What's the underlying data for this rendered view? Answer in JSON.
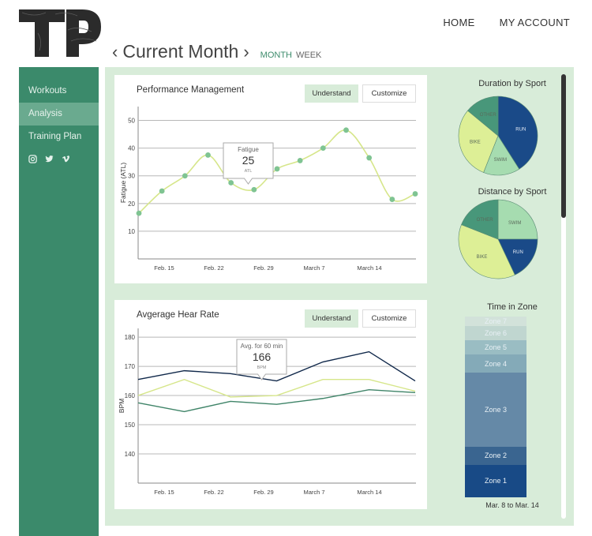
{
  "brand": {
    "logo_text": "TP"
  },
  "topnav": {
    "home": "HOME",
    "account": "MY ACCOUNT"
  },
  "month_bar": {
    "prev": "‹",
    "title": "Current Month",
    "next": "›",
    "month_toggle": "MONTH",
    "week_toggle": "WEEK"
  },
  "sidebar": {
    "items": [
      {
        "label": "Workouts",
        "active": false
      },
      {
        "label": "Analysis",
        "active": true
      },
      {
        "label": "Training Plan",
        "active": false
      }
    ],
    "social": [
      "instagram-icon",
      "twitter-icon",
      "vimeo-icon"
    ]
  },
  "buttons": {
    "understand": "Understand",
    "customize": "Customize"
  },
  "colors": {
    "sidebar": "#3b8a6b",
    "panel_bg": "#d8ecd9",
    "fatigue_line": "#d6e68a",
    "fatigue_dot": "#7fc492",
    "hr_dark": "#10284a",
    "hr_light": "#d6e68a",
    "hr_green": "#3f8468"
  },
  "chart_data": [
    {
      "type": "line",
      "title": "Performance Management",
      "ylabel": "Fatigue (ATL)",
      "xlabel": "",
      "ylim": [
        0,
        55
      ],
      "y_ticks": [
        10,
        20,
        30,
        40,
        50
      ],
      "x_ticks": [
        "Feb. 15",
        "Feb. 22",
        "Feb. 29",
        "March 7",
        "March 14"
      ],
      "grid": true,
      "series": [
        {
          "values": [
            16.5,
            24.5,
            30,
            37.5,
            27.5,
            25,
            32.5,
            35.5,
            40,
            46.5,
            36.5,
            21.5,
            23.5
          ]
        }
      ],
      "tooltip": {
        "label": "Fatigue",
        "value": "25",
        "unit": "ATL"
      }
    },
    {
      "type": "line",
      "title": "Avgerage Hear Rate",
      "ylabel": "BPM",
      "xlabel": "",
      "ylim": [
        130,
        183
      ],
      "y_ticks": [
        140,
        150,
        160,
        170,
        180
      ],
      "x_ticks": [
        "Feb. 15",
        "Feb. 22",
        "Feb. 29",
        "March 7",
        "March 14"
      ],
      "grid": true,
      "series": [
        {
          "values": [
            165.5,
            168.5,
            167.5,
            165,
            171.5,
            175,
            165
          ]
        },
        {
          "values": [
            160,
            165.5,
            159.5,
            160,
            165.5,
            165.5,
            161.5
          ]
        },
        {
          "values": [
            157.5,
            154.5,
            158,
            157,
            159,
            162,
            161
          ]
        }
      ],
      "tooltip": {
        "label": "Avg. for 60 min",
        "value": "166",
        "unit": "BPM"
      }
    },
    {
      "type": "pie",
      "title": "Duration by Sport",
      "slices": [
        {
          "label": "RUN",
          "value": 41,
          "color": "#1a4a88"
        },
        {
          "label": "SWIM",
          "value": 15,
          "color": "#a6dcb0"
        },
        {
          "label": "BIKE",
          "value": 30,
          "color": "#ddef96"
        },
        {
          "label": "OTHER",
          "value": 14,
          "color": "#48977a"
        }
      ]
    },
    {
      "type": "pie",
      "title": "Distance by Sport",
      "slices": [
        {
          "label": "SWIM",
          "value": 25,
          "color": "#a6dcb0"
        },
        {
          "label": "RUN",
          "value": 18,
          "color": "#1a4a88"
        },
        {
          "label": "BIKE",
          "value": 38,
          "color": "#ddef96"
        },
        {
          "label": "OTHER",
          "value": 19,
          "color": "#48977a"
        }
      ]
    },
    {
      "type": "bar",
      "title": "Time in Zone",
      "caption": "Mar. 8 to Mar. 14",
      "zones": [
        {
          "label": "Zone 7",
          "value": 5,
          "color": "#d2e2da"
        },
        {
          "label": "Zone 6",
          "value": 8,
          "color": "#c0d6d0"
        },
        {
          "label": "Zone 5",
          "value": 8,
          "color": "#9abdc3"
        },
        {
          "label": "Zone 4",
          "value": 10,
          "color": "#84aab8"
        },
        {
          "label": "Zone 3",
          "value": 41,
          "color": "#6589a7"
        },
        {
          "label": "Zone 2",
          "value": 10,
          "color": "#3a6590"
        },
        {
          "label": "Zone 1",
          "value": 18,
          "color": "#184a86"
        }
      ]
    }
  ]
}
